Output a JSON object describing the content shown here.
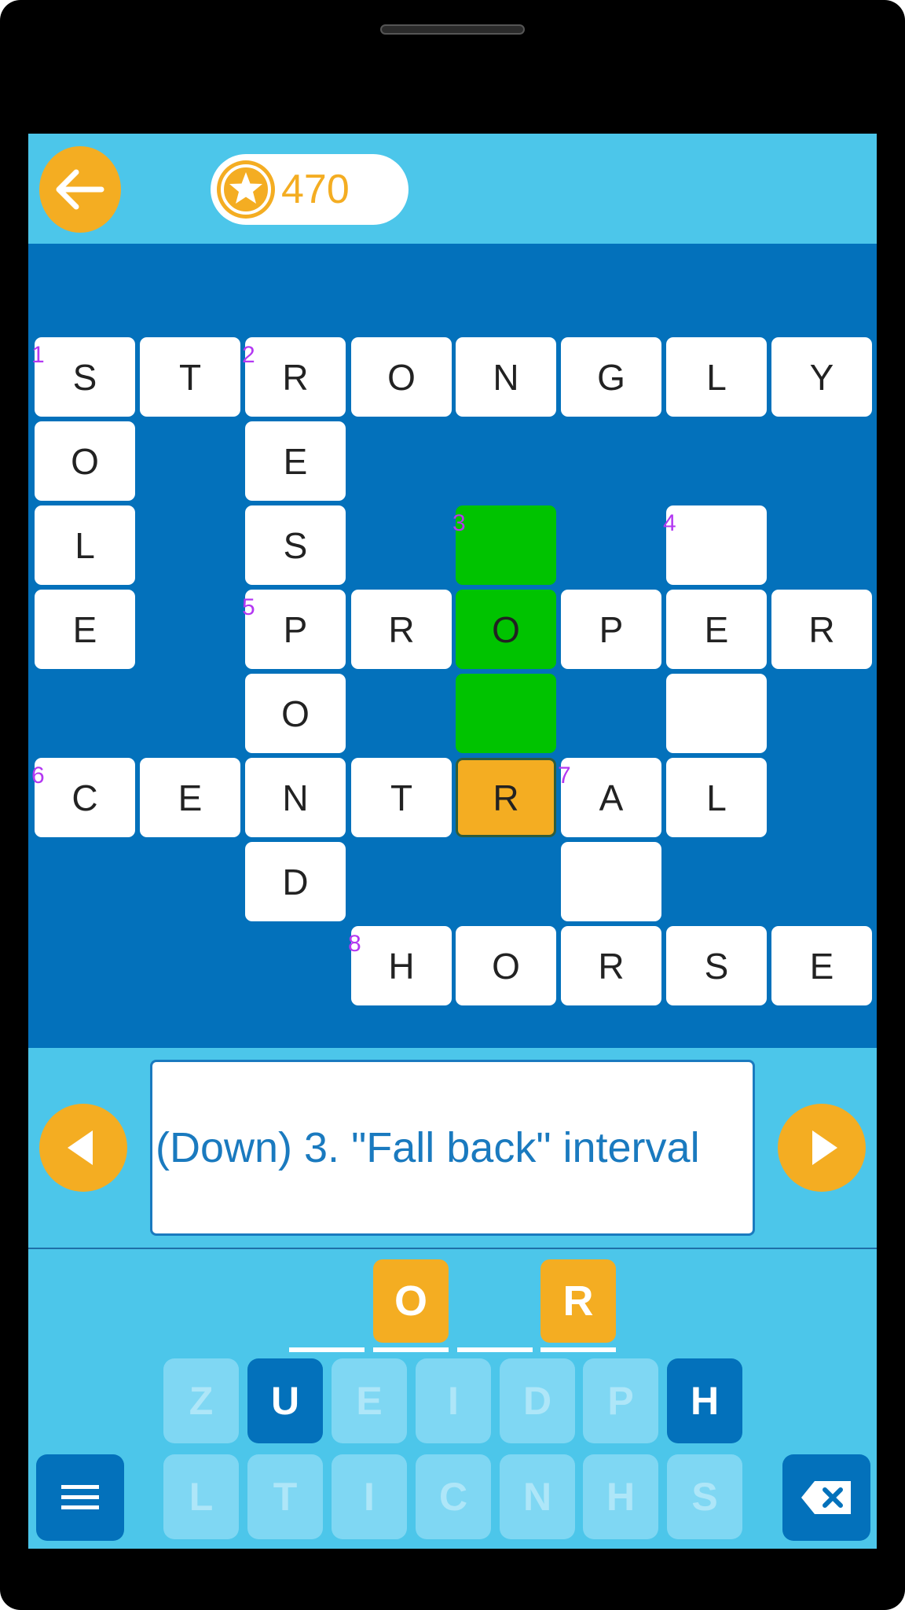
{
  "header": {
    "coins": "470",
    "back_icon": "arrow-left-icon",
    "coin_icon": "star-coin-icon"
  },
  "colors": {
    "sky": "#4cc6ea",
    "board": "#0371bb",
    "accent": "#f4ad22",
    "highlight": "#00c300",
    "clue_number": "#b338f2"
  },
  "grid": [
    {
      "row": 0,
      "col": 0,
      "letter": "S",
      "num": "1"
    },
    {
      "row": 0,
      "col": 1,
      "letter": "T"
    },
    {
      "row": 0,
      "col": 2,
      "letter": "R",
      "num": "2"
    },
    {
      "row": 0,
      "col": 3,
      "letter": "O"
    },
    {
      "row": 0,
      "col": 4,
      "letter": "N"
    },
    {
      "row": 0,
      "col": 5,
      "letter": "G"
    },
    {
      "row": 0,
      "col": 6,
      "letter": "L"
    },
    {
      "row": 0,
      "col": 7,
      "letter": "Y"
    },
    {
      "row": 1,
      "col": 0,
      "letter": "O"
    },
    {
      "row": 1,
      "col": 2,
      "letter": "E"
    },
    {
      "row": 2,
      "col": 0,
      "letter": "L"
    },
    {
      "row": 2,
      "col": 2,
      "letter": "S"
    },
    {
      "row": 2,
      "col": 4,
      "letter": "",
      "num": "3",
      "state": "green"
    },
    {
      "row": 2,
      "col": 6,
      "letter": "",
      "num": "4"
    },
    {
      "row": 3,
      "col": 0,
      "letter": "E"
    },
    {
      "row": 3,
      "col": 2,
      "letter": "P",
      "num": "5"
    },
    {
      "row": 3,
      "col": 3,
      "letter": "R"
    },
    {
      "row": 3,
      "col": 4,
      "letter": "O",
      "state": "green"
    },
    {
      "row": 3,
      "col": 5,
      "letter": "P"
    },
    {
      "row": 3,
      "col": 6,
      "letter": "E"
    },
    {
      "row": 3,
      "col": 7,
      "letter": "R"
    },
    {
      "row": 4,
      "col": 2,
      "letter": "O"
    },
    {
      "row": 4,
      "col": 4,
      "letter": "",
      "state": "green"
    },
    {
      "row": 4,
      "col": 6,
      "letter": ""
    },
    {
      "row": 5,
      "col": 0,
      "letter": "C",
      "num": "6"
    },
    {
      "row": 5,
      "col": 1,
      "letter": "E"
    },
    {
      "row": 5,
      "col": 2,
      "letter": "N"
    },
    {
      "row": 5,
      "col": 3,
      "letter": "T"
    },
    {
      "row": 5,
      "col": 4,
      "letter": "R",
      "state": "orange"
    },
    {
      "row": 5,
      "col": 5,
      "letter": "A",
      "num": "7"
    },
    {
      "row": 5,
      "col": 6,
      "letter": "L"
    },
    {
      "row": 6,
      "col": 2,
      "letter": "D"
    },
    {
      "row": 6,
      "col": 5,
      "letter": ""
    },
    {
      "row": 7,
      "col": 3,
      "letter": "H",
      "num": "8"
    },
    {
      "row": 7,
      "col": 4,
      "letter": "O"
    },
    {
      "row": 7,
      "col": 5,
      "letter": "R"
    },
    {
      "row": 7,
      "col": 6,
      "letter": "S"
    },
    {
      "row": 7,
      "col": 7,
      "letter": "E"
    }
  ],
  "clue": {
    "text": "(Down) 3. \"Fall back\" interval",
    "prev_icon": "triangle-left-icon",
    "next_icon": "triangle-right-icon"
  },
  "answer_slots": [
    "",
    "O",
    "",
    "R"
  ],
  "keyboard": {
    "row1": [
      {
        "label": "Z",
        "active": false
      },
      {
        "label": "U",
        "active": true
      },
      {
        "label": "E",
        "active": false
      },
      {
        "label": "I",
        "active": false
      },
      {
        "label": "D",
        "active": false
      },
      {
        "label": "P",
        "active": false
      },
      {
        "label": "H",
        "active": true
      }
    ],
    "row2": [
      {
        "label": "L",
        "active": false
      },
      {
        "label": "T",
        "active": false
      },
      {
        "label": "I",
        "active": false
      },
      {
        "label": "C",
        "active": false
      },
      {
        "label": "N",
        "active": false
      },
      {
        "label": "H",
        "active": false
      },
      {
        "label": "S",
        "active": false
      }
    ],
    "menu_icon": "hamburger-menu-icon",
    "delete_icon": "backspace-icon"
  }
}
